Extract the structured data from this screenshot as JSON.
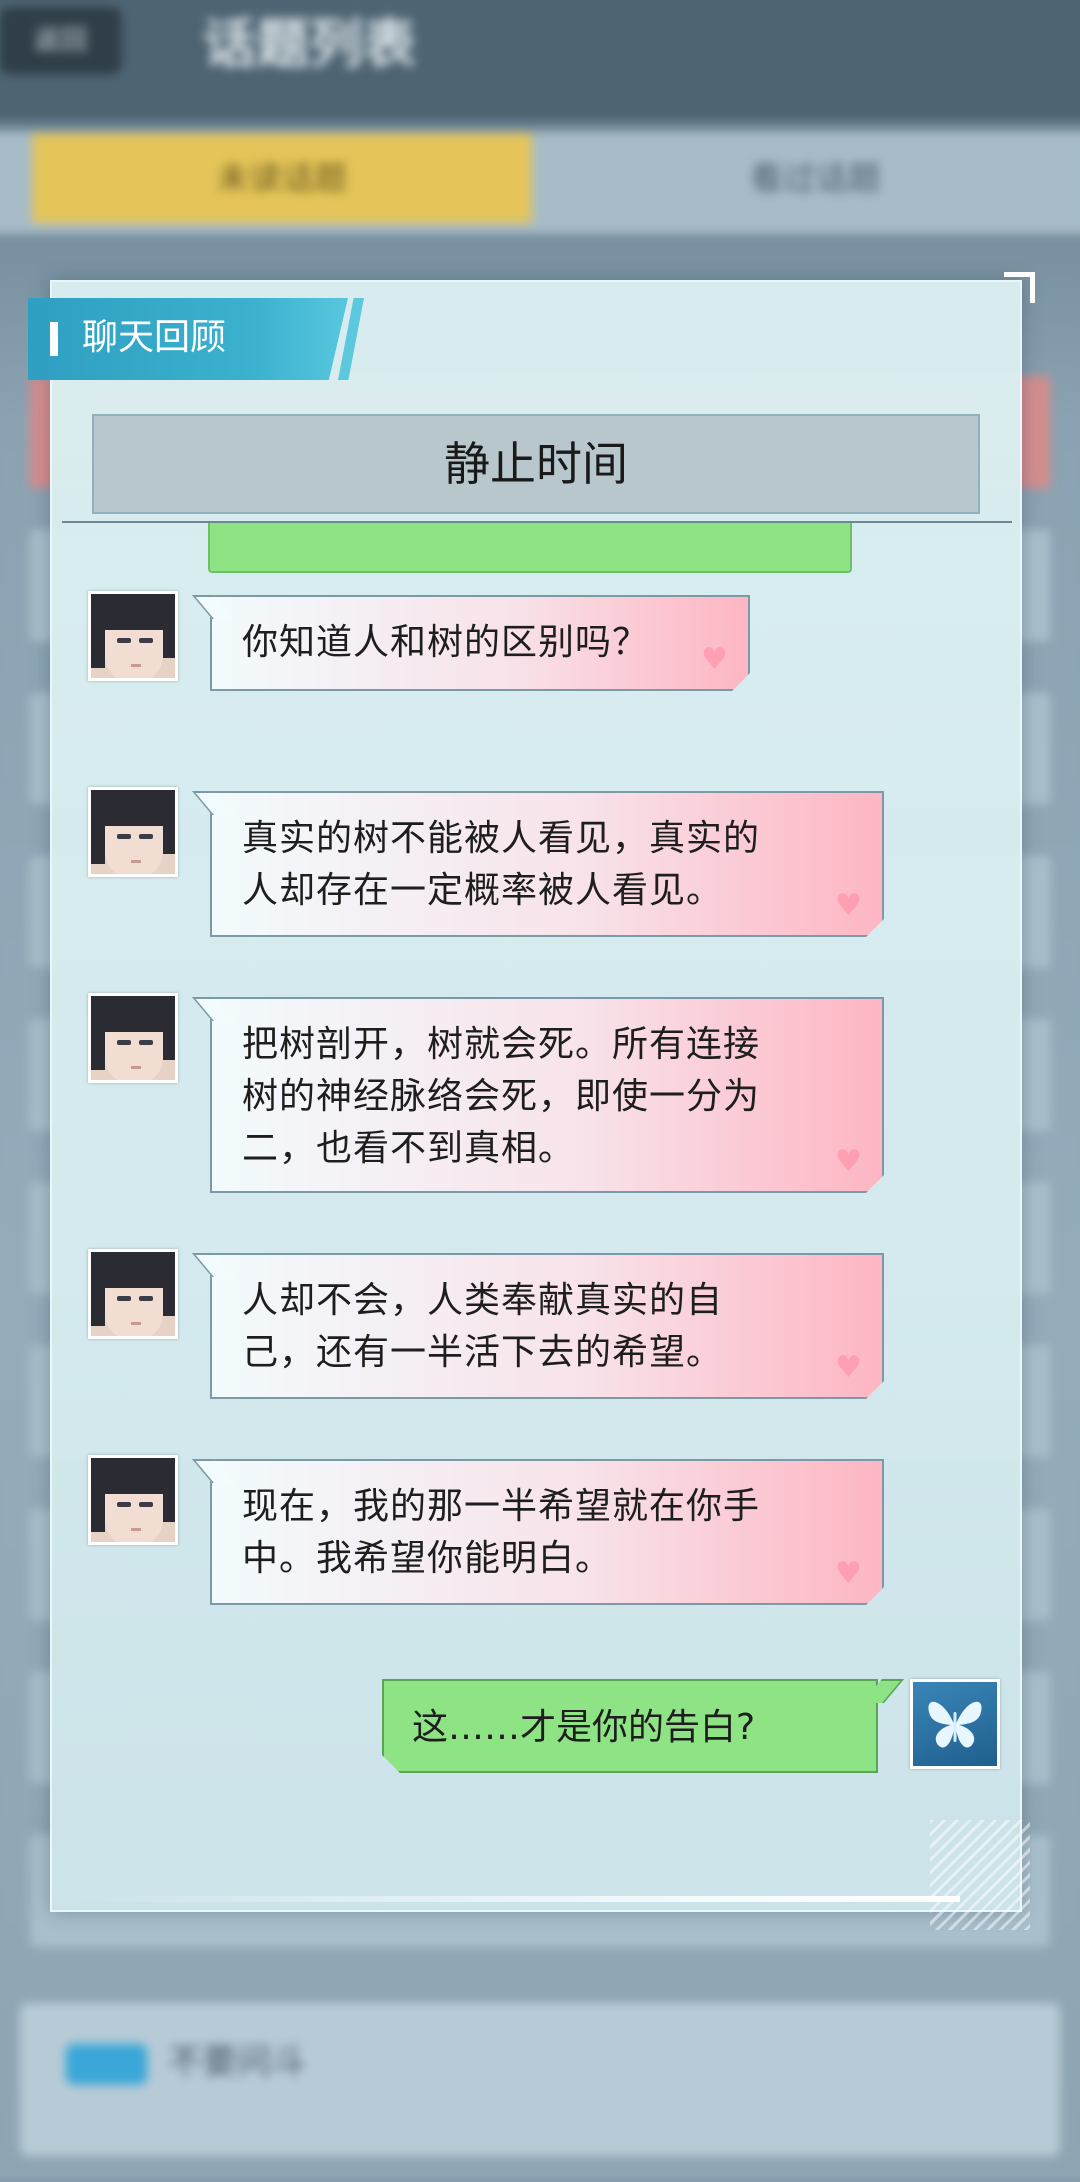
{
  "background": {
    "back_label": "返回",
    "page_title": "话题列表",
    "tab_active": "未读话题",
    "tab_inactive": "看过话题",
    "bottom_item": "不要问斗"
  },
  "dialog": {
    "header_label": "聊天回顾",
    "title": "静止时间",
    "messages": [
      {
        "sender": "other",
        "text": "你知道人和树的区别吗？"
      },
      {
        "sender": "other",
        "lines": [
          "真实的树不能被人看见，真实的",
          "人却存在一定概率被人看见。"
        ]
      },
      {
        "sender": "other",
        "lines": [
          "把树剖开，树就会死。所有连接",
          "树的神经脉络会死，即使一分为",
          "二，也看不到真相。"
        ]
      },
      {
        "sender": "other",
        "lines": [
          "人却不会，人类奉献真实的自",
          "己，还有一半活下去的希望。"
        ]
      },
      {
        "sender": "other",
        "lines": [
          "现在，我的那一半希望就在你手",
          "中。我希望你能明白。"
        ]
      },
      {
        "sender": "me",
        "text": "这……才是你的告白?"
      }
    ]
  },
  "colors": {
    "accent": "#3bb1cf",
    "my_bubble": "#8ee385",
    "their_bubble_end": "#fdb6c3",
    "heart": "#ff9fb3"
  },
  "icons": {
    "other_avatar": "character-portrait-icon",
    "me_avatar": "butterfly-icon",
    "bubble_decoration": "heart-icon"
  }
}
